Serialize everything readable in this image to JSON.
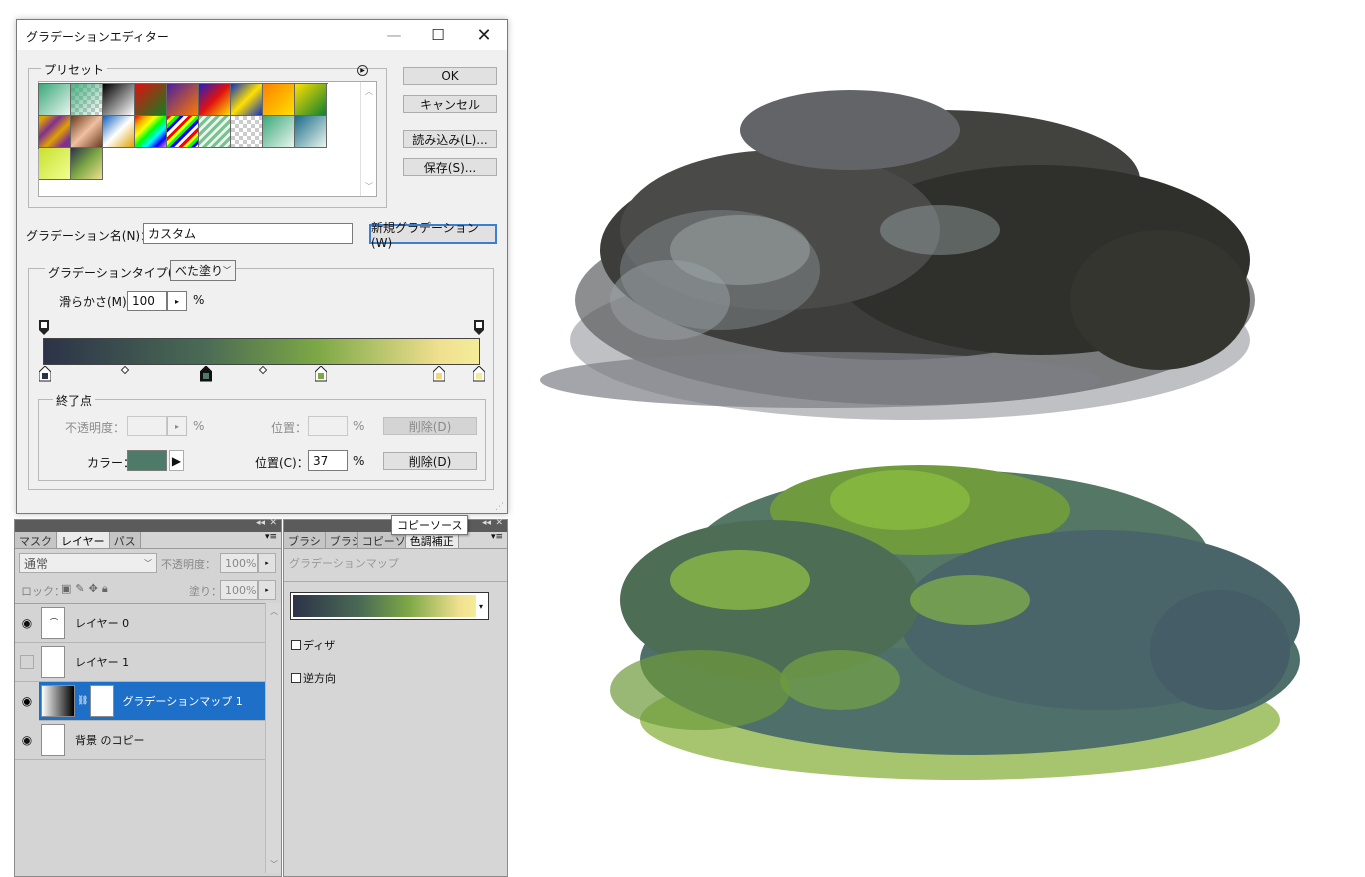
{
  "dialog": {
    "title": "グラデーションエディター",
    "controls": {
      "minimize": "—",
      "maximize": "☐",
      "close": "✕"
    },
    "presets_label": "プリセット",
    "buttons": {
      "ok": "OK",
      "cancel": "キャンセル",
      "load": "読み込み(L)...",
      "save": "保存(S)..."
    },
    "name_label": "グラデーション名(N)：",
    "name_value": "カスタム",
    "new_gradient": "新規グラデーション(W)",
    "type_label": "グラデーションタイプ(T)：",
    "type_value": "べた塗り",
    "smooth_label": "滑らかさ(M)：",
    "smooth_value": "100",
    "percent": "%",
    "stops_label": "終了点",
    "opacity_label": "不透明度：",
    "opacity_value": "",
    "opacity_pos_label": "位置：",
    "opacity_pos_value": "",
    "delete_disabled": "削除(D)",
    "color_label": "カラー：",
    "color_value": "#4e7a6a",
    "color_pos_label": "位置(C)：",
    "color_pos_value": "37",
    "delete": "削除(D)",
    "gradient_colors": [
      "#2c3348",
      "#4a6b55",
      "#7da845",
      "#f0e090"
    ]
  },
  "layers_panel": {
    "tabs": [
      "マスク",
      "レイヤー",
      "パス"
    ],
    "active_tab": "レイヤー",
    "blend_mode": "通常",
    "opacity_label": "不透明度：",
    "opacity_value": "100%",
    "lock_label": "ロック：",
    "fill_label": "塗り：",
    "fill_value": "100%",
    "layers": [
      {
        "name": "レイヤー 0",
        "visible": true
      },
      {
        "name": "レイヤー 1",
        "visible": false
      },
      {
        "name": "グラデーションマップ 1",
        "visible": true,
        "selected": true
      },
      {
        "name": "背景 のコピー",
        "visible": true
      }
    ]
  },
  "adjust_panel": {
    "tabs": [
      "ブラシ",
      "ブラシ",
      "コピーソ",
      "色調補正"
    ],
    "active_tab": "色調補正",
    "tooltip": "コピーソース",
    "header": "グラデーションマップ",
    "dither_label": "ディザ",
    "reverse_label": "逆方向"
  }
}
